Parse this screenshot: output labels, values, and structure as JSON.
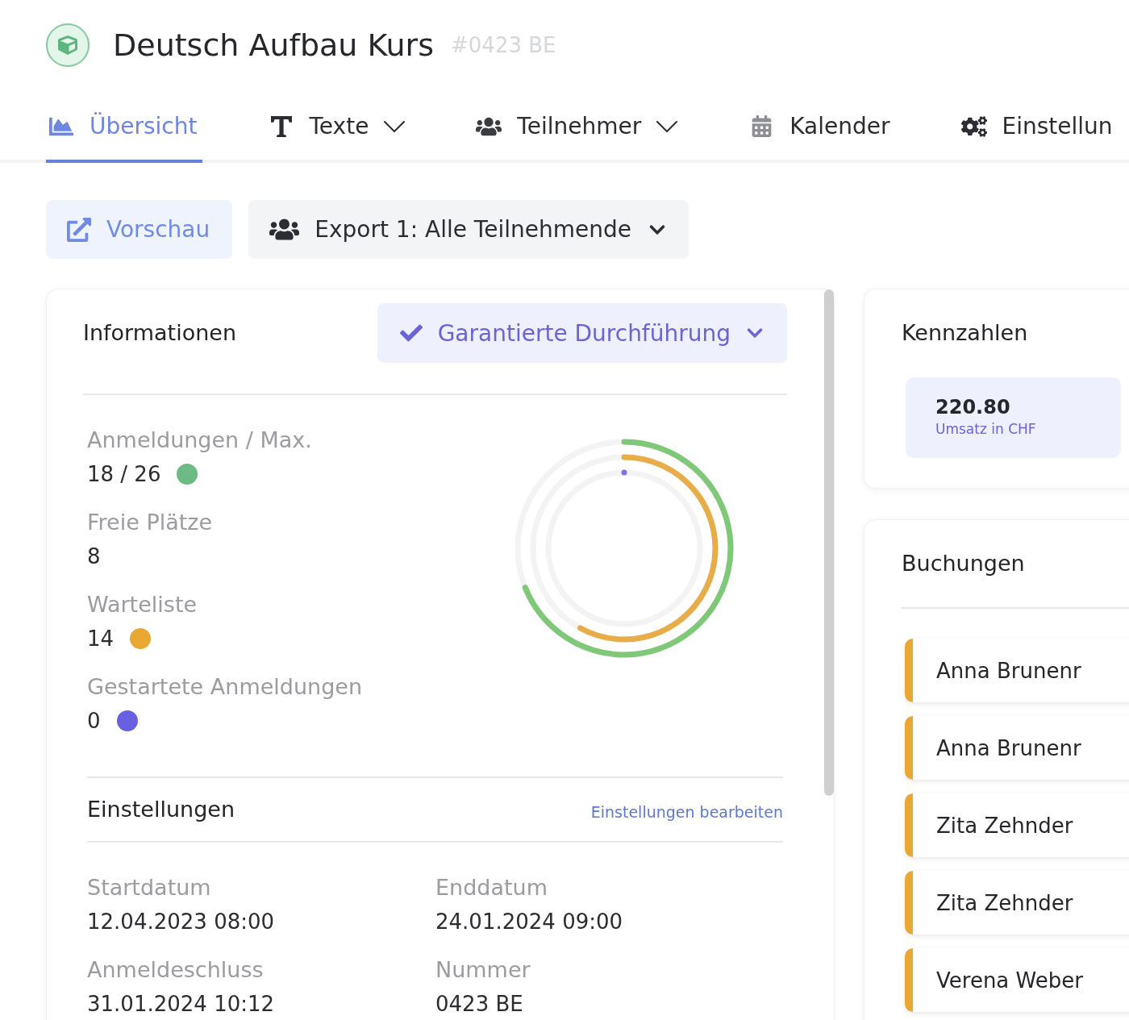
{
  "header": {
    "title": "Deutsch Aufbau Kurs",
    "code": "#0423 BE"
  },
  "tabs": [
    {
      "label": "Übersicht",
      "selected": true,
      "dropdown": false
    },
    {
      "label": "Texte",
      "selected": false,
      "dropdown": true
    },
    {
      "label": "Teilnehmer",
      "selected": false,
      "dropdown": true
    },
    {
      "label": "Kalender",
      "selected": false,
      "dropdown": false
    },
    {
      "label": "Einstellun",
      "selected": false,
      "dropdown": false
    }
  ],
  "actions": [
    {
      "kind": "preview",
      "label": "Vorschau"
    },
    {
      "kind": "export",
      "label": "Export 1: Alle Teilnehmende"
    }
  ],
  "info_card": {
    "title": "Informationen",
    "status": {
      "label": "Garantierte Durchführung"
    },
    "stats": [
      {
        "label": "Anmeldungen / Max.",
        "value": "18 / 26",
        "color": "#6cba86"
      },
      {
        "label": "Freie Plätze",
        "value": "8"
      },
      {
        "label": "Warteliste",
        "value": "14",
        "color": "#e9a834"
      },
      {
        "label": "Gestartete Anmeldungen",
        "value": "0",
        "color": "#6860e0"
      }
    ],
    "settings": {
      "title": "Einstellungen",
      "link": "Einstellungen bearbeiten",
      "fields": [
        {
          "label": "Startdatum",
          "value": "12.04.2023 08:00"
        },
        {
          "label": "Enddatum",
          "value": "24.01.2024 09:00"
        },
        {
          "label": "Anmeldeschluss",
          "value": "31.01.2024 10:12"
        },
        {
          "label": "Nummer",
          "value": "0423 BE"
        }
      ]
    }
  },
  "metrics_card": {
    "title": "Kennzahlen",
    "metrics": [
      {
        "value": "220.80",
        "label": "Umsatz in CHF"
      }
    ]
  },
  "bookings_card": {
    "title": "Buchungen",
    "items": [
      {
        "name": "Anna Brunenr"
      },
      {
        "name": "Anna Brunenr"
      },
      {
        "name": "Zita Zehnder"
      },
      {
        "name": "Zita Zehnder"
      },
      {
        "name": "Verena Weber"
      }
    ]
  }
}
